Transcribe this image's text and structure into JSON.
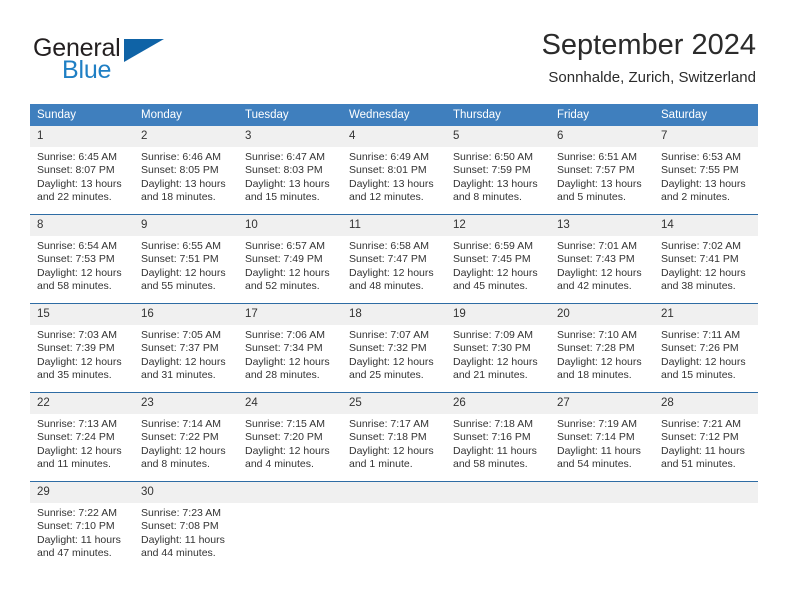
{
  "brand": {
    "word_one": "General",
    "word_two": "Blue",
    "flag_icon": "triangle-flag-icon",
    "accent_color": "#0f63a6",
    "blue_text_color": "#1f7fc4"
  },
  "header": {
    "title": "September 2024",
    "subtitle": "Sonnhalde, Zurich, Switzerland"
  },
  "theme": {
    "header_row_bg": "#3f7fbe",
    "daynum_bg": "#f0f0f0",
    "row_divider": "#2e6ca4",
    "text": "#333333"
  },
  "calendar": {
    "weekday_headers": [
      "Sunday",
      "Monday",
      "Tuesday",
      "Wednesday",
      "Thursday",
      "Friday",
      "Saturday"
    ],
    "weeks": [
      [
        {
          "day": "1",
          "sunrise": "Sunrise: 6:45 AM",
          "sunset": "Sunset: 8:07 PM",
          "daylight_line1": "Daylight: 13 hours",
          "daylight_line2": "and 22 minutes."
        },
        {
          "day": "2",
          "sunrise": "Sunrise: 6:46 AM",
          "sunset": "Sunset: 8:05 PM",
          "daylight_line1": "Daylight: 13 hours",
          "daylight_line2": "and 18 minutes."
        },
        {
          "day": "3",
          "sunrise": "Sunrise: 6:47 AM",
          "sunset": "Sunset: 8:03 PM",
          "daylight_line1": "Daylight: 13 hours",
          "daylight_line2": "and 15 minutes."
        },
        {
          "day": "4",
          "sunrise": "Sunrise: 6:49 AM",
          "sunset": "Sunset: 8:01 PM",
          "daylight_line1": "Daylight: 13 hours",
          "daylight_line2": "and 12 minutes."
        },
        {
          "day": "5",
          "sunrise": "Sunrise: 6:50 AM",
          "sunset": "Sunset: 7:59 PM",
          "daylight_line1": "Daylight: 13 hours",
          "daylight_line2": "and 8 minutes."
        },
        {
          "day": "6",
          "sunrise": "Sunrise: 6:51 AM",
          "sunset": "Sunset: 7:57 PM",
          "daylight_line1": "Daylight: 13 hours",
          "daylight_line2": "and 5 minutes."
        },
        {
          "day": "7",
          "sunrise": "Sunrise: 6:53 AM",
          "sunset": "Sunset: 7:55 PM",
          "daylight_line1": "Daylight: 13 hours",
          "daylight_line2": "and 2 minutes."
        }
      ],
      [
        {
          "day": "8",
          "sunrise": "Sunrise: 6:54 AM",
          "sunset": "Sunset: 7:53 PM",
          "daylight_line1": "Daylight: 12 hours",
          "daylight_line2": "and 58 minutes."
        },
        {
          "day": "9",
          "sunrise": "Sunrise: 6:55 AM",
          "sunset": "Sunset: 7:51 PM",
          "daylight_line1": "Daylight: 12 hours",
          "daylight_line2": "and 55 minutes."
        },
        {
          "day": "10",
          "sunrise": "Sunrise: 6:57 AM",
          "sunset": "Sunset: 7:49 PM",
          "daylight_line1": "Daylight: 12 hours",
          "daylight_line2": "and 52 minutes."
        },
        {
          "day": "11",
          "sunrise": "Sunrise: 6:58 AM",
          "sunset": "Sunset: 7:47 PM",
          "daylight_line1": "Daylight: 12 hours",
          "daylight_line2": "and 48 minutes."
        },
        {
          "day": "12",
          "sunrise": "Sunrise: 6:59 AM",
          "sunset": "Sunset: 7:45 PM",
          "daylight_line1": "Daylight: 12 hours",
          "daylight_line2": "and 45 minutes."
        },
        {
          "day": "13",
          "sunrise": "Sunrise: 7:01 AM",
          "sunset": "Sunset: 7:43 PM",
          "daylight_line1": "Daylight: 12 hours",
          "daylight_line2": "and 42 minutes."
        },
        {
          "day": "14",
          "sunrise": "Sunrise: 7:02 AM",
          "sunset": "Sunset: 7:41 PM",
          "daylight_line1": "Daylight: 12 hours",
          "daylight_line2": "and 38 minutes."
        }
      ],
      [
        {
          "day": "15",
          "sunrise": "Sunrise: 7:03 AM",
          "sunset": "Sunset: 7:39 PM",
          "daylight_line1": "Daylight: 12 hours",
          "daylight_line2": "and 35 minutes."
        },
        {
          "day": "16",
          "sunrise": "Sunrise: 7:05 AM",
          "sunset": "Sunset: 7:37 PM",
          "daylight_line1": "Daylight: 12 hours",
          "daylight_line2": "and 31 minutes."
        },
        {
          "day": "17",
          "sunrise": "Sunrise: 7:06 AM",
          "sunset": "Sunset: 7:34 PM",
          "daylight_line1": "Daylight: 12 hours",
          "daylight_line2": "and 28 minutes."
        },
        {
          "day": "18",
          "sunrise": "Sunrise: 7:07 AM",
          "sunset": "Sunset: 7:32 PM",
          "daylight_line1": "Daylight: 12 hours",
          "daylight_line2": "and 25 minutes."
        },
        {
          "day": "19",
          "sunrise": "Sunrise: 7:09 AM",
          "sunset": "Sunset: 7:30 PM",
          "daylight_line1": "Daylight: 12 hours",
          "daylight_line2": "and 21 minutes."
        },
        {
          "day": "20",
          "sunrise": "Sunrise: 7:10 AM",
          "sunset": "Sunset: 7:28 PM",
          "daylight_line1": "Daylight: 12 hours",
          "daylight_line2": "and 18 minutes."
        },
        {
          "day": "21",
          "sunrise": "Sunrise: 7:11 AM",
          "sunset": "Sunset: 7:26 PM",
          "daylight_line1": "Daylight: 12 hours",
          "daylight_line2": "and 15 minutes."
        }
      ],
      [
        {
          "day": "22",
          "sunrise": "Sunrise: 7:13 AM",
          "sunset": "Sunset: 7:24 PM",
          "daylight_line1": "Daylight: 12 hours",
          "daylight_line2": "and 11 minutes."
        },
        {
          "day": "23",
          "sunrise": "Sunrise: 7:14 AM",
          "sunset": "Sunset: 7:22 PM",
          "daylight_line1": "Daylight: 12 hours",
          "daylight_line2": "and 8 minutes."
        },
        {
          "day": "24",
          "sunrise": "Sunrise: 7:15 AM",
          "sunset": "Sunset: 7:20 PM",
          "daylight_line1": "Daylight: 12 hours",
          "daylight_line2": "and 4 minutes."
        },
        {
          "day": "25",
          "sunrise": "Sunrise: 7:17 AM",
          "sunset": "Sunset: 7:18 PM",
          "daylight_line1": "Daylight: 12 hours",
          "daylight_line2": "and 1 minute."
        },
        {
          "day": "26",
          "sunrise": "Sunrise: 7:18 AM",
          "sunset": "Sunset: 7:16 PM",
          "daylight_line1": "Daylight: 11 hours",
          "daylight_line2": "and 58 minutes."
        },
        {
          "day": "27",
          "sunrise": "Sunrise: 7:19 AM",
          "sunset": "Sunset: 7:14 PM",
          "daylight_line1": "Daylight: 11 hours",
          "daylight_line2": "and 54 minutes."
        },
        {
          "day": "28",
          "sunrise": "Sunrise: 7:21 AM",
          "sunset": "Sunset: 7:12 PM",
          "daylight_line1": "Daylight: 11 hours",
          "daylight_line2": "and 51 minutes."
        }
      ],
      [
        {
          "day": "29",
          "sunrise": "Sunrise: 7:22 AM",
          "sunset": "Sunset: 7:10 PM",
          "daylight_line1": "Daylight: 11 hours",
          "daylight_line2": "and 47 minutes."
        },
        {
          "day": "30",
          "sunrise": "Sunrise: 7:23 AM",
          "sunset": "Sunset: 7:08 PM",
          "daylight_line1": "Daylight: 11 hours",
          "daylight_line2": "and 44 minutes."
        },
        {
          "day": "",
          "sunrise": "",
          "sunset": "",
          "daylight_line1": "",
          "daylight_line2": ""
        },
        {
          "day": "",
          "sunrise": "",
          "sunset": "",
          "daylight_line1": "",
          "daylight_line2": ""
        },
        {
          "day": "",
          "sunrise": "",
          "sunset": "",
          "daylight_line1": "",
          "daylight_line2": ""
        },
        {
          "day": "",
          "sunrise": "",
          "sunset": "",
          "daylight_line1": "",
          "daylight_line2": ""
        },
        {
          "day": "",
          "sunrise": "",
          "sunset": "",
          "daylight_line1": "",
          "daylight_line2": ""
        }
      ]
    ]
  }
}
